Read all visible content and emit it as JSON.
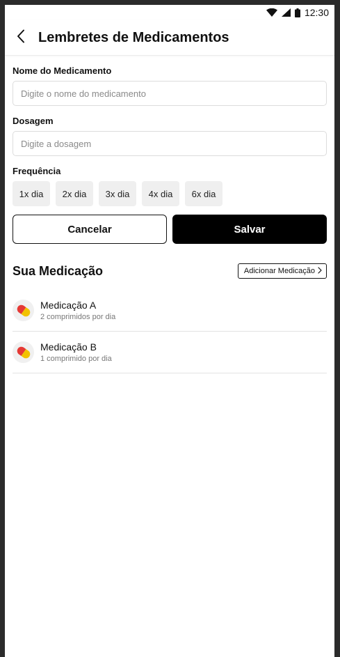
{
  "status_bar": {
    "time": "12:30"
  },
  "header": {
    "title": "Lembretes de Medicamentos"
  },
  "form": {
    "name_label": "Nome do Medicamento",
    "name_placeholder": "Digite o nome do medicamento",
    "name_value": "",
    "dosage_label": "Dosagem",
    "dosage_placeholder": "Digite a dosagem",
    "dosage_value": "",
    "frequency_label": "Frequência",
    "frequency_options": [
      "1x dia",
      "2x dia",
      "3x dia",
      "4x dia",
      "6x dia"
    ],
    "cancel_label": "Cancelar",
    "save_label": "Salvar"
  },
  "medications": {
    "title": "Sua Medicação",
    "add_label": "Adicionar Medicação",
    "items": [
      {
        "name": "Medicação A",
        "dosage": "2 comprimidos por dia"
      },
      {
        "name": "Medicação B",
        "dosage": "1 comprimido por dia"
      }
    ]
  },
  "icons": {
    "back": "chevron-left-icon",
    "add": "chevron-right-icon",
    "pill": "pill-icon",
    "wifi": "wifi-icon",
    "signal": "signal-icon",
    "battery": "battery-icon"
  },
  "colors": {
    "primary": "#000000",
    "chip_bg": "#efefef",
    "pill_red": "#e53935",
    "pill_yellow": "#f2c200"
  }
}
